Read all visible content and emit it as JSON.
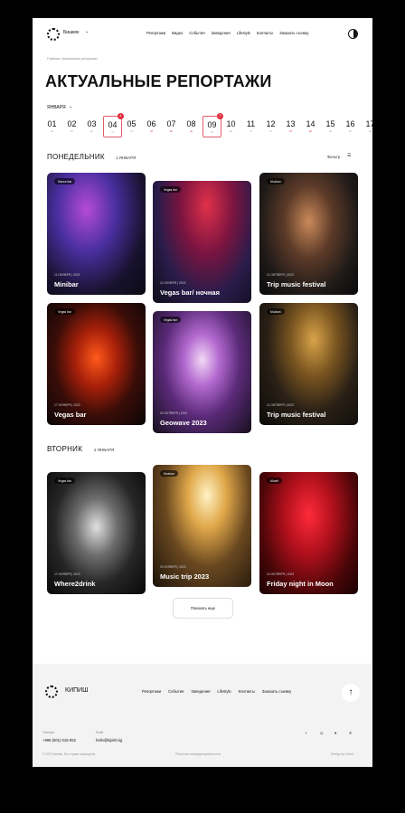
{
  "header": {
    "city": "Бишкек",
    "nav": [
      "Репортажи",
      "Видео",
      "События",
      "Заведения",
      "Lifestyle",
      "Контакты",
      "Заказать съемку"
    ]
  },
  "breadcrumb": "Главная / Актуальные репортажи",
  "page_title": "АКТУАЛЬНЫЕ РЕПОРТАЖИ",
  "month": "ЯНВАРЯ",
  "dates": [
    {
      "n": "01",
      "w": "пн"
    },
    {
      "n": "02",
      "w": "вт"
    },
    {
      "n": "03",
      "w": "ср"
    },
    {
      "n": "04",
      "w": "чт",
      "badge": "4"
    },
    {
      "n": "05",
      "w": "пт"
    },
    {
      "n": "06",
      "w": "сб",
      "we": true
    },
    {
      "n": "07",
      "w": "вс",
      "we": true
    },
    {
      "n": "08",
      "w": "пн",
      "we": true
    },
    {
      "n": "09",
      "w": "вт",
      "badge": "2"
    },
    {
      "n": "10",
      "w": "ср"
    },
    {
      "n": "11",
      "w": "чт"
    },
    {
      "n": "12",
      "w": "пт"
    },
    {
      "n": "13",
      "w": "сб",
      "we": true
    },
    {
      "n": "14",
      "w": "вс",
      "we": true
    },
    {
      "n": "15",
      "w": "пн"
    },
    {
      "n": "16",
      "w": "вт"
    },
    {
      "n": "17",
      "w": "ср"
    }
  ],
  "filter": "Фильтр",
  "sections": [
    {
      "title": "ПОНЕДЕЛЬНИК",
      "date": "1 ЯНВАРЯ",
      "cards": [
        {
          "tag": "Dance bar",
          "date": "11 НОЯБРЯ | 2023",
          "title": "Minibar",
          "bg": "radial-gradient(ellipse at 40% 30%,#b54bd8 0%,#4a2fa0 35%,#18122e 70%,#0a0a14 100%)"
        },
        {
          "tag": "Vegas bar",
          "date": "11 НОЯБРЯ | 2023",
          "title": "Vegas bar/ ночная",
          "bg": "radial-gradient(ellipse at 55% 20%,#e0304a 0%,#7a1440 35%,#2a1c4a 65%,#0d0d1a 100%)"
        },
        {
          "tag": "Muzkan",
          "date": "11 ОКТЯБРЯ | 2023",
          "title": "Trip music festival",
          "bg": "radial-gradient(ellipse at 50% 40%,#c98a5a 0%,#5c3a28 35%,#1e1a18 70%,#0a0a0a 100%)"
        },
        {
          "tag": "Vegas bar",
          "date": "17 НОЯБРЯ | 2023",
          "title": "Vegas bar",
          "bg": "radial-gradient(ellipse at 50% 45%,#ff5a1a 0%,#a8200a 30%,#3a0d08 60%,#0a0606 100%)"
        },
        {
          "tag": "Vegas bar",
          "date": "02 ОКТЯБРЯ | 2023",
          "title": "Geowave 2023",
          "bg": "radial-gradient(ellipse at 50% 40%,#f2d8f4 0%,#b36ad0 25%,#5a2a78 55%,#16101e 100%)"
        },
        {
          "tag": "Muzkan",
          "date": "11 ОКТЯБРЯ | 2023",
          "title": "Trip music festival",
          "bg": "radial-gradient(ellipse at 55% 30%,#d9a44a 0%,#7a5520 30%,#2a2016 60%,#0a0a08 100%)"
        }
      ]
    },
    {
      "title": "ВТОРНИК",
      "date": "2 ЯНВАРЯ",
      "cards": [
        {
          "tag": "Vegas bar",
          "date": "17 НОЯБРЯ | 2023",
          "title": "Where2drink",
          "bg": "radial-gradient(ellipse at 50% 45%,#e0e0e0 0%,#6e6e6e 30%,#262626 60%,#080808 100%)"
        },
        {
          "tag": "Muzkan",
          "date": "03 НОЯБРЯ | 2023",
          "title": "Music trip 2023",
          "bg": "radial-gradient(ellipse at 55% 25%,#fff2c4 0%,#e0a84a 25%,#6a4820 55%,#1a120a 100%)"
        },
        {
          "tag": "Muzef",
          "date": "24 ОКТЯБРЯ | 2023",
          "title": "Friday night in Moon",
          "bg": "radial-gradient(ellipse at 50% 35%,#ff2a3a 0%,#b0101c 35%,#4a0608 70%,#1a0204 100%)"
        }
      ]
    }
  ],
  "show_more": "Показать еще",
  "footer": {
    "name": "КИПИШ",
    "nav": [
      "Репортажи",
      "События",
      "Заведения",
      "Lifestyle",
      "Контакты",
      "Заказать съемку"
    ],
    "phone_label": "Телефон",
    "phone": "+996 (501) 015-052",
    "mail_label": "Email",
    "mail": "hello@kipish.kg",
    "social": [
      "f",
      "◎",
      "♥",
      "✆"
    ],
    "copyright": "© 2023 Кипиш. Все права защищены.",
    "privacy": "Политика конфиденциальности",
    "credit": "Design by Fabric"
  }
}
